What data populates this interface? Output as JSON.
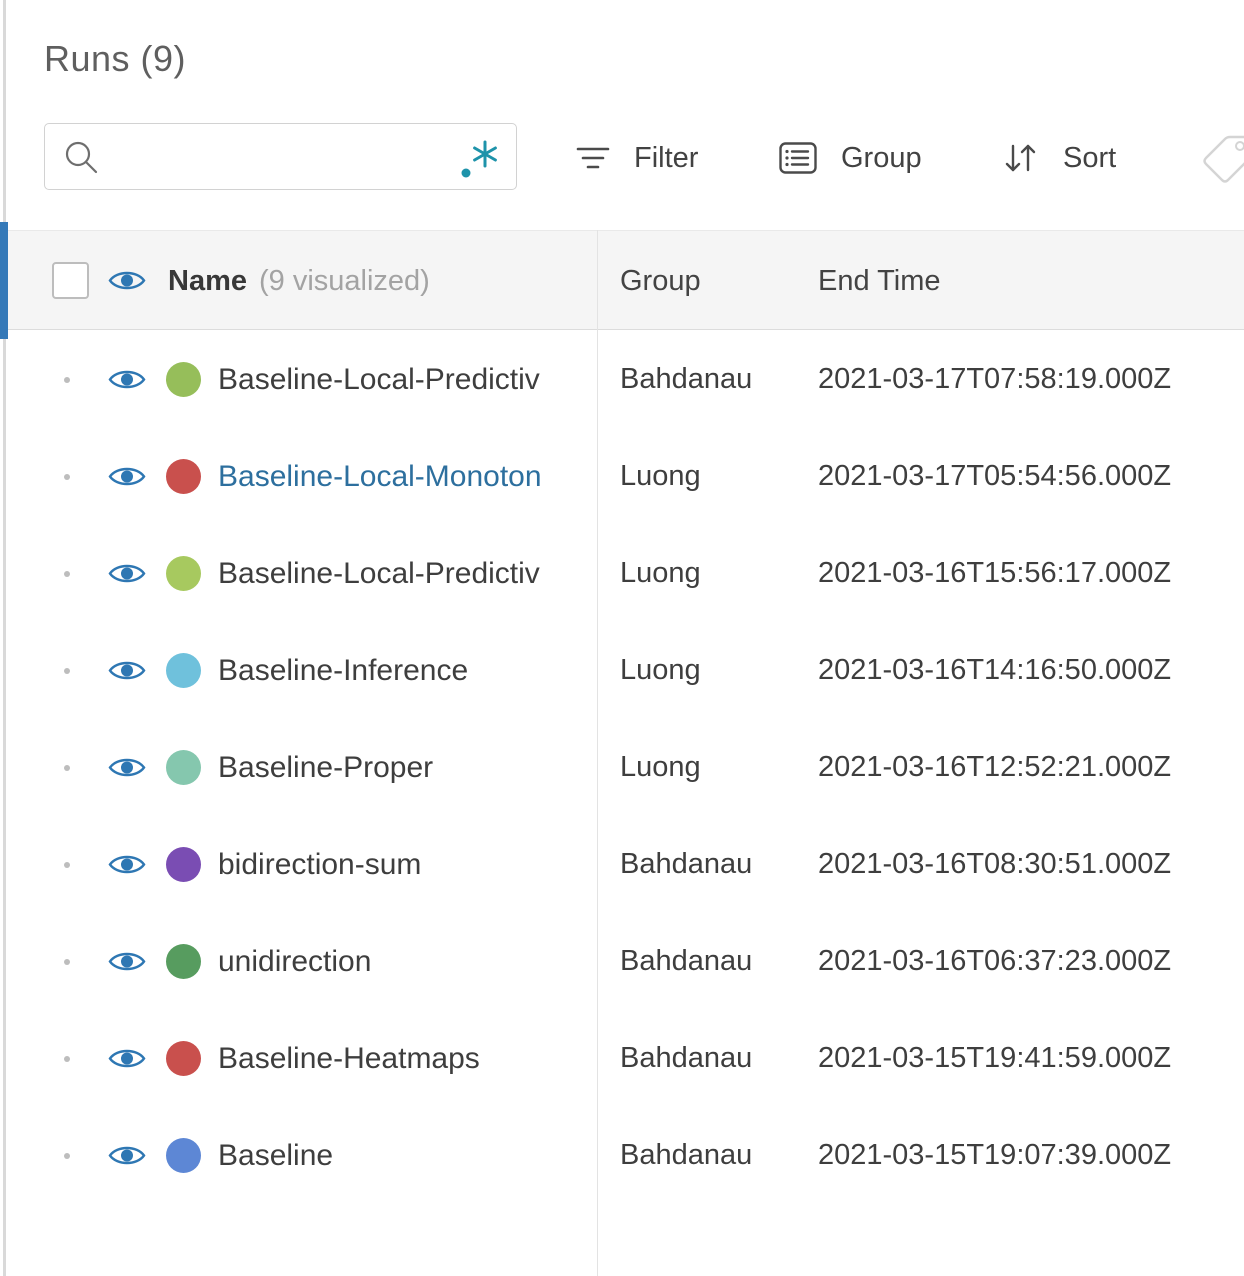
{
  "header": {
    "title": "Runs (9)",
    "search": {
      "value": "",
      "placeholder": ""
    },
    "filter_label": "Filter",
    "group_label": "Group",
    "sort_label": "Sort"
  },
  "table": {
    "columns": {
      "name": "Name",
      "name_note": "(9 visualized)",
      "group": "Group",
      "end_time": "End Time"
    },
    "visualized_count": 9,
    "rows": [
      {
        "name": "Baseline-Local-Predictiv",
        "dot_color": "#96be5a",
        "group": "Bahdanau",
        "end_time": "2021-03-17T07:58:19.000Z",
        "name_is_link": false
      },
      {
        "name": "Baseline-Local-Monoton",
        "dot_color": "#c9504d",
        "group": "Luong",
        "end_time": "2021-03-17T05:54:56.000Z",
        "name_is_link": true
      },
      {
        "name": "Baseline-Local-Predictiv",
        "dot_color": "#a7c95f",
        "group": "Luong",
        "end_time": "2021-03-16T15:56:17.000Z",
        "name_is_link": false
      },
      {
        "name": "Baseline-Inference",
        "dot_color": "#6fc1dc",
        "group": "Luong",
        "end_time": "2021-03-16T14:16:50.000Z",
        "name_is_link": false
      },
      {
        "name": "Baseline-Proper",
        "dot_color": "#85c7ae",
        "group": "Luong",
        "end_time": "2021-03-16T12:52:21.000Z",
        "name_is_link": false
      },
      {
        "name": "bidirection-sum",
        "dot_color": "#7a4db3",
        "group": "Bahdanau",
        "end_time": "2021-03-16T08:30:51.000Z",
        "name_is_link": false
      },
      {
        "name": "unidirection",
        "dot_color": "#579c5f",
        "group": "Bahdanau",
        "end_time": "2021-03-16T06:37:23.000Z",
        "name_is_link": false
      },
      {
        "name": "Baseline-Heatmaps",
        "dot_color": "#c9504d",
        "group": "Bahdanau",
        "end_time": "2021-03-15T19:41:59.000Z",
        "name_is_link": false
      },
      {
        "name": "Baseline",
        "dot_color": "#5d87d5",
        "group": "Bahdanau",
        "end_time": "2021-03-15T19:07:39.000Z",
        "name_is_link": false
      }
    ]
  },
  "colors": {
    "accent_blue": "#3579b8",
    "eye_blue": "#2e77b3",
    "link_blue": "#2d6f9e",
    "regex_teal": "#1e93aa",
    "header_bg": "#f5f5f5"
  }
}
